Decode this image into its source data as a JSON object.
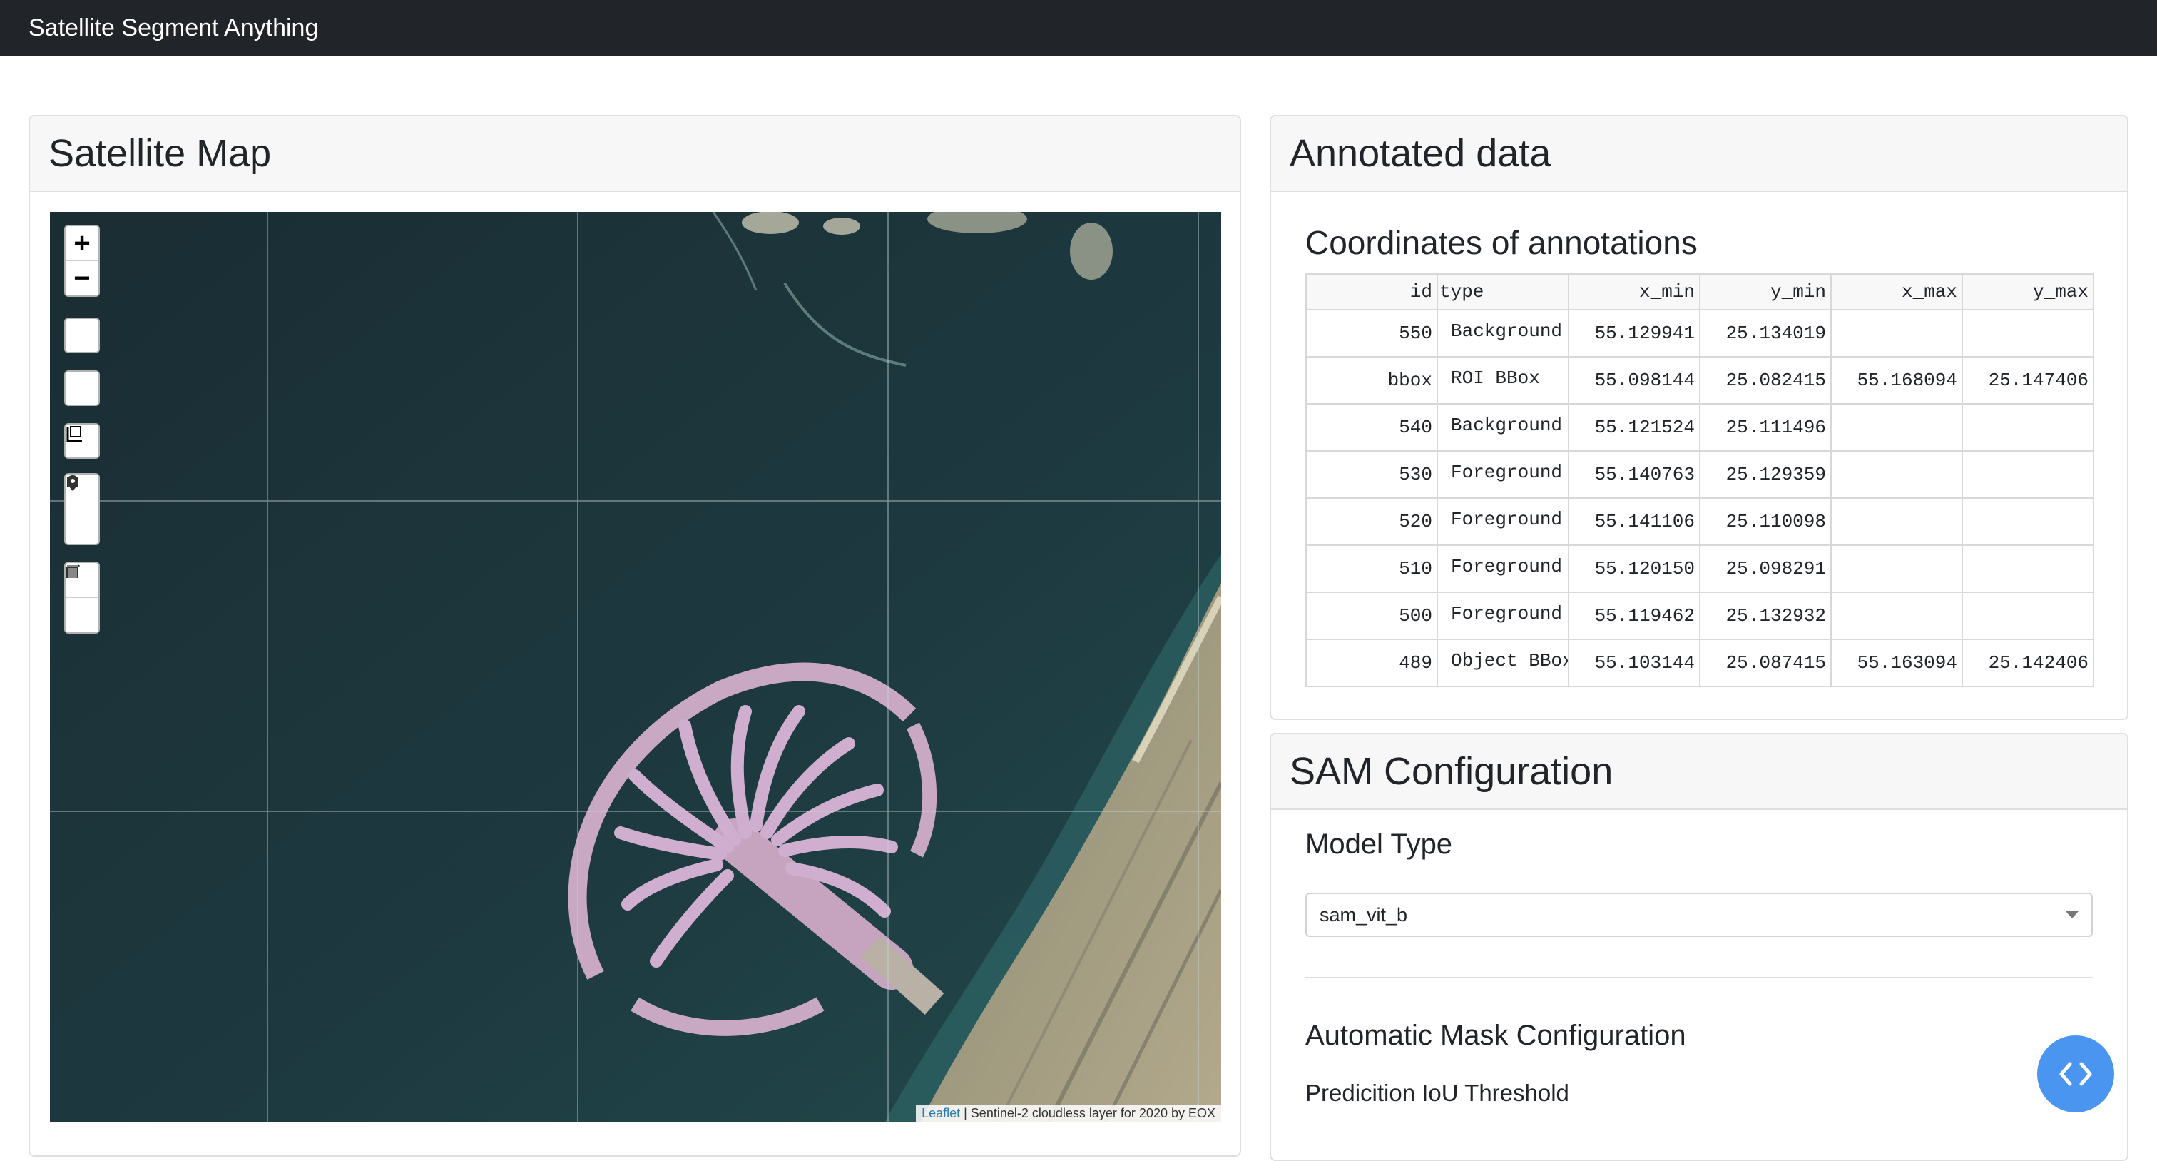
{
  "navbar": {
    "title": "Satellite Segment Anything"
  },
  "map_card": {
    "header": "Satellite Map",
    "zoom_in": "+",
    "zoom_out": "−",
    "attribution_link": "Leaflet",
    "attribution_text": " | Sentinel-2 cloudless layer for 2020 by EOX"
  },
  "annotations_card": {
    "header": "Annotated data",
    "subtitle": "Coordinates of annotations",
    "columns": [
      "id",
      "type",
      "x_min",
      "y_min",
      "x_max",
      "y_max"
    ],
    "rows": [
      {
        "id": "550",
        "type": "Background",
        "x_min": "55.129941",
        "y_min": "25.134019",
        "x_max": "",
        "y_max": ""
      },
      {
        "id": "bbox",
        "type": "ROI BBox",
        "x_min": "55.098144",
        "y_min": "25.082415",
        "x_max": "55.168094",
        "y_max": "25.147406"
      },
      {
        "id": "540",
        "type": "Background",
        "x_min": "55.121524",
        "y_min": "25.111496",
        "x_max": "",
        "y_max": ""
      },
      {
        "id": "530",
        "type": "Foreground",
        "x_min": "55.140763",
        "y_min": "25.129359",
        "x_max": "",
        "y_max": ""
      },
      {
        "id": "520",
        "type": "Foreground",
        "x_min": "55.141106",
        "y_min": "25.110098",
        "x_max": "",
        "y_max": ""
      },
      {
        "id": "510",
        "type": "Foreground",
        "x_min": "55.120150",
        "y_min": "25.098291",
        "x_max": "",
        "y_max": ""
      },
      {
        "id": "500",
        "type": "Foreground",
        "x_min": "55.119462",
        "y_min": "25.132932",
        "x_max": "",
        "y_max": ""
      },
      {
        "id": "489",
        "type": "Object BBox",
        "x_min": "55.103144",
        "y_min": "25.087415",
        "x_max": "55.163094",
        "y_max": "25.142406"
      }
    ]
  },
  "sam_card": {
    "header": "SAM Configuration",
    "model_label": "Model Type",
    "model_value": "sam_vit_b",
    "auto_title": "Automatic Mask Configuration",
    "iou_label": "Predicition IoU Threshold"
  },
  "colors": {
    "navbar": "#212529",
    "fab": "#4a95ef",
    "link": "#2a7ab0",
    "water": "#1c3238"
  },
  "icons": [
    "zoom-in-icon",
    "zoom-out-icon",
    "scale-icon",
    "rectangle-icon",
    "marker-icon",
    "edit-icon",
    "trash-icon",
    "code-icon"
  ]
}
